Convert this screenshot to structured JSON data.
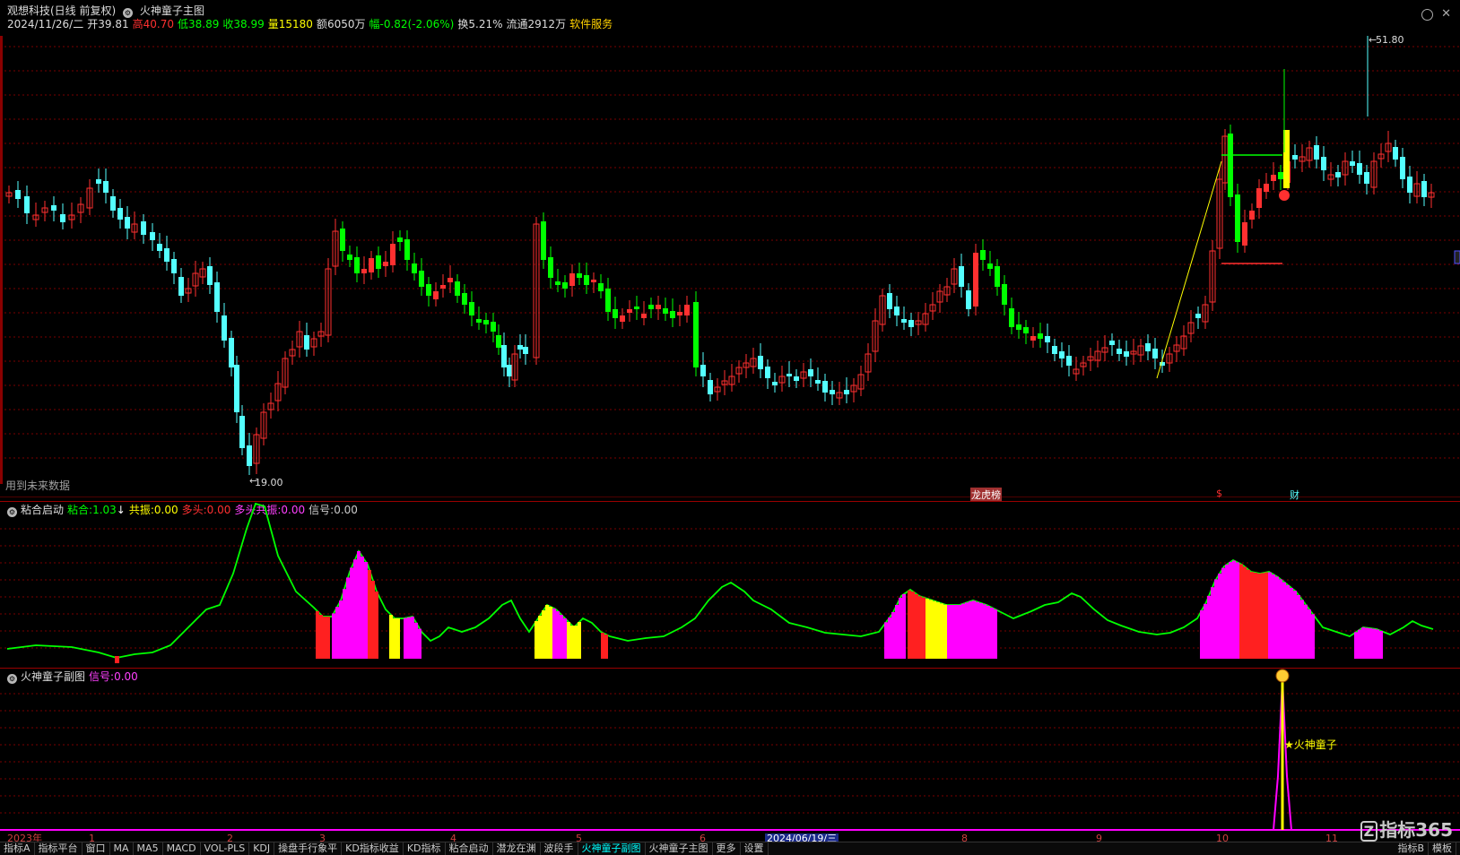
{
  "header": {
    "stock_name": "观想科技(日线 前复权)",
    "indicator_name": "火神童子主图",
    "date": "2024/11/26/二",
    "open_label": "开",
    "open": "39.81",
    "high_label": "高",
    "high": "40.70",
    "low_label": "低",
    "low": "38.89",
    "close_label": "收",
    "close": "38.99",
    "volume_label": "量",
    "volume": "15180",
    "amount_label": "额",
    "amount": "6050万",
    "change_label": "幅",
    "change": "-0.82(-2.06%)",
    "turnover_label": "换",
    "turnover": "5.21%",
    "float_label": "流通",
    "float": "2912万",
    "service": "软件服务"
  },
  "main_chart": {
    "future_data_note": "用到未来数据",
    "high_marker": "51.80",
    "low_marker": "19.00",
    "event_badges": [
      "龙虎榜",
      "$",
      "财"
    ]
  },
  "sub1": {
    "title": "粘合启动",
    "fields": [
      {
        "label": "粘合:",
        "value": "1.03",
        "color": "#00ff00"
      },
      {
        "label": "共振:",
        "value": "0.00",
        "color": "#ffff00"
      },
      {
        "label": "多头:",
        "value": "0.00",
        "color": "#ff3030"
      },
      {
        "label": "多头共振:",
        "value": "0.00",
        "color": "#ff40ff"
      },
      {
        "label": "信号:",
        "value": "0.00",
        "color": "#cccccc"
      }
    ],
    "arrow": "↓"
  },
  "sub2": {
    "title": "火神童子副图",
    "signal_label": "信号:",
    "signal_value": "0.00",
    "annotation": "★火神童子"
  },
  "date_axis": {
    "labels": [
      "2023年",
      "1",
      "2",
      "3",
      "4",
      "5",
      "6",
      "2024/06/19/三",
      "8",
      "9",
      "10",
      "11"
    ]
  },
  "tabs": [
    "指标A",
    "指标平台",
    "窗口",
    "MA",
    "MA5",
    "MACD",
    "VOL-PLS",
    "KDJ",
    "操盘手行象平",
    "KD指标收益",
    "KD指标",
    "粘合启动",
    "潜龙在渊",
    "波段手",
    "火神童子副图",
    "火神童子主图",
    "更多",
    "设置"
  ],
  "tabs_right": [
    "指标B",
    "模板"
  ],
  "logo": "指标365",
  "colors": {
    "up": "#ff3030",
    "down": "#54ffff",
    "green_signal": "#00ff00",
    "yellow": "#ffff00",
    "magenta": "#ff00ff",
    "grid": "#7a0000"
  },
  "chart_data": {
    "type": "candlestick",
    "y_price_high": 51.8,
    "y_price_low": 19.0,
    "last_close": 38.99
  }
}
